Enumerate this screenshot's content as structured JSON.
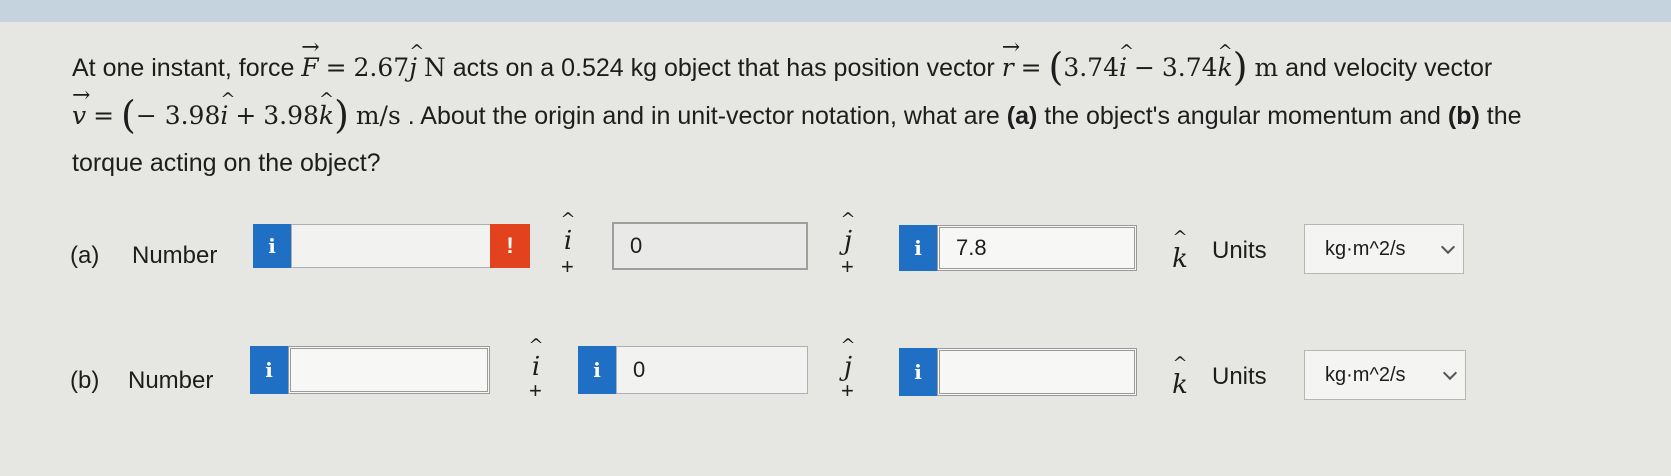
{
  "question": {
    "t1": "At one instant, force ",
    "F_sym": "F",
    "eq": "=",
    "F_val": "2.67",
    "j_sym": "j",
    "N": "N",
    "t2": " acts on a 0.524 kg object that has position vector ",
    "r_sym": "r",
    "r_a": "3.74",
    "i_sym": "i",
    "minus": "−",
    "r_b": "3.74",
    "k_sym": "k",
    "m": "m",
    "t3": " and velocity vector",
    "v_sym": "v",
    "v_a": "− 3.98",
    "plus": "+",
    "v_b": "3.98",
    "ms": "m/s",
    "t4": " . About the origin and in unit-vector notation, what are ",
    "a_tag": "(a)",
    "t5": " the object's angular momentum and ",
    "b_tag": "(b)",
    "t6": " the",
    "t7": "torque acting on the object?"
  },
  "part_a": {
    "tag": "(a)",
    "label": "Number",
    "i_value": "",
    "j_value": "0",
    "k_value": "7.8",
    "units_label": "Units",
    "units_value": "kg·m^2/s"
  },
  "part_b": {
    "tag": "(b)",
    "label": "Number",
    "i_value": "",
    "j_value": "0",
    "k_value": "",
    "units_label": "Units",
    "units_value": "kg·m^2/s"
  },
  "symbols": {
    "info": "i",
    "warn": "!",
    "i": "i",
    "j": "j",
    "k": "k",
    "plus": "+",
    "hat": "^"
  },
  "colors": {
    "info_blue": "#1f6fc5",
    "warn_red": "#e2421e",
    "top_bar": "#c4d3dd"
  },
  "icons": [
    "info-icon",
    "warning-icon",
    "chevron-down-icon"
  ]
}
